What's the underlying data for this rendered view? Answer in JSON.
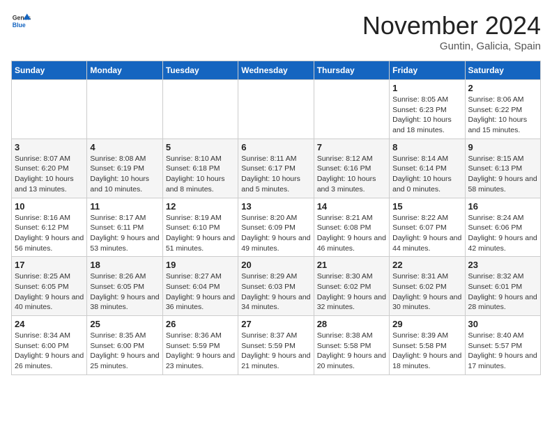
{
  "logo": {
    "general": "General",
    "blue": "Blue"
  },
  "title": "November 2024",
  "location": "Guntin, Galicia, Spain",
  "days_of_week": [
    "Sunday",
    "Monday",
    "Tuesday",
    "Wednesday",
    "Thursday",
    "Friday",
    "Saturday"
  ],
  "weeks": [
    [
      {
        "day": "",
        "info": ""
      },
      {
        "day": "",
        "info": ""
      },
      {
        "day": "",
        "info": ""
      },
      {
        "day": "",
        "info": ""
      },
      {
        "day": "",
        "info": ""
      },
      {
        "day": "1",
        "info": "Sunrise: 8:05 AM\nSunset: 6:23 PM\nDaylight: 10 hours and 18 minutes."
      },
      {
        "day": "2",
        "info": "Sunrise: 8:06 AM\nSunset: 6:22 PM\nDaylight: 10 hours and 15 minutes."
      }
    ],
    [
      {
        "day": "3",
        "info": "Sunrise: 8:07 AM\nSunset: 6:20 PM\nDaylight: 10 hours and 13 minutes."
      },
      {
        "day": "4",
        "info": "Sunrise: 8:08 AM\nSunset: 6:19 PM\nDaylight: 10 hours and 10 minutes."
      },
      {
        "day": "5",
        "info": "Sunrise: 8:10 AM\nSunset: 6:18 PM\nDaylight: 10 hours and 8 minutes."
      },
      {
        "day": "6",
        "info": "Sunrise: 8:11 AM\nSunset: 6:17 PM\nDaylight: 10 hours and 5 minutes."
      },
      {
        "day": "7",
        "info": "Sunrise: 8:12 AM\nSunset: 6:16 PM\nDaylight: 10 hours and 3 minutes."
      },
      {
        "day": "8",
        "info": "Sunrise: 8:14 AM\nSunset: 6:14 PM\nDaylight: 10 hours and 0 minutes."
      },
      {
        "day": "9",
        "info": "Sunrise: 8:15 AM\nSunset: 6:13 PM\nDaylight: 9 hours and 58 minutes."
      }
    ],
    [
      {
        "day": "10",
        "info": "Sunrise: 8:16 AM\nSunset: 6:12 PM\nDaylight: 9 hours and 56 minutes."
      },
      {
        "day": "11",
        "info": "Sunrise: 8:17 AM\nSunset: 6:11 PM\nDaylight: 9 hours and 53 minutes."
      },
      {
        "day": "12",
        "info": "Sunrise: 8:19 AM\nSunset: 6:10 PM\nDaylight: 9 hours and 51 minutes."
      },
      {
        "day": "13",
        "info": "Sunrise: 8:20 AM\nSunset: 6:09 PM\nDaylight: 9 hours and 49 minutes."
      },
      {
        "day": "14",
        "info": "Sunrise: 8:21 AM\nSunset: 6:08 PM\nDaylight: 9 hours and 46 minutes."
      },
      {
        "day": "15",
        "info": "Sunrise: 8:22 AM\nSunset: 6:07 PM\nDaylight: 9 hours and 44 minutes."
      },
      {
        "day": "16",
        "info": "Sunrise: 8:24 AM\nSunset: 6:06 PM\nDaylight: 9 hours and 42 minutes."
      }
    ],
    [
      {
        "day": "17",
        "info": "Sunrise: 8:25 AM\nSunset: 6:05 PM\nDaylight: 9 hours and 40 minutes."
      },
      {
        "day": "18",
        "info": "Sunrise: 8:26 AM\nSunset: 6:05 PM\nDaylight: 9 hours and 38 minutes."
      },
      {
        "day": "19",
        "info": "Sunrise: 8:27 AM\nSunset: 6:04 PM\nDaylight: 9 hours and 36 minutes."
      },
      {
        "day": "20",
        "info": "Sunrise: 8:29 AM\nSunset: 6:03 PM\nDaylight: 9 hours and 34 minutes."
      },
      {
        "day": "21",
        "info": "Sunrise: 8:30 AM\nSunset: 6:02 PM\nDaylight: 9 hours and 32 minutes."
      },
      {
        "day": "22",
        "info": "Sunrise: 8:31 AM\nSunset: 6:02 PM\nDaylight: 9 hours and 30 minutes."
      },
      {
        "day": "23",
        "info": "Sunrise: 8:32 AM\nSunset: 6:01 PM\nDaylight: 9 hours and 28 minutes."
      }
    ],
    [
      {
        "day": "24",
        "info": "Sunrise: 8:34 AM\nSunset: 6:00 PM\nDaylight: 9 hours and 26 minutes."
      },
      {
        "day": "25",
        "info": "Sunrise: 8:35 AM\nSunset: 6:00 PM\nDaylight: 9 hours and 25 minutes."
      },
      {
        "day": "26",
        "info": "Sunrise: 8:36 AM\nSunset: 5:59 PM\nDaylight: 9 hours and 23 minutes."
      },
      {
        "day": "27",
        "info": "Sunrise: 8:37 AM\nSunset: 5:59 PM\nDaylight: 9 hours and 21 minutes."
      },
      {
        "day": "28",
        "info": "Sunrise: 8:38 AM\nSunset: 5:58 PM\nDaylight: 9 hours and 20 minutes."
      },
      {
        "day": "29",
        "info": "Sunrise: 8:39 AM\nSunset: 5:58 PM\nDaylight: 9 hours and 18 minutes."
      },
      {
        "day": "30",
        "info": "Sunrise: 8:40 AM\nSunset: 5:57 PM\nDaylight: 9 hours and 17 minutes."
      }
    ]
  ]
}
